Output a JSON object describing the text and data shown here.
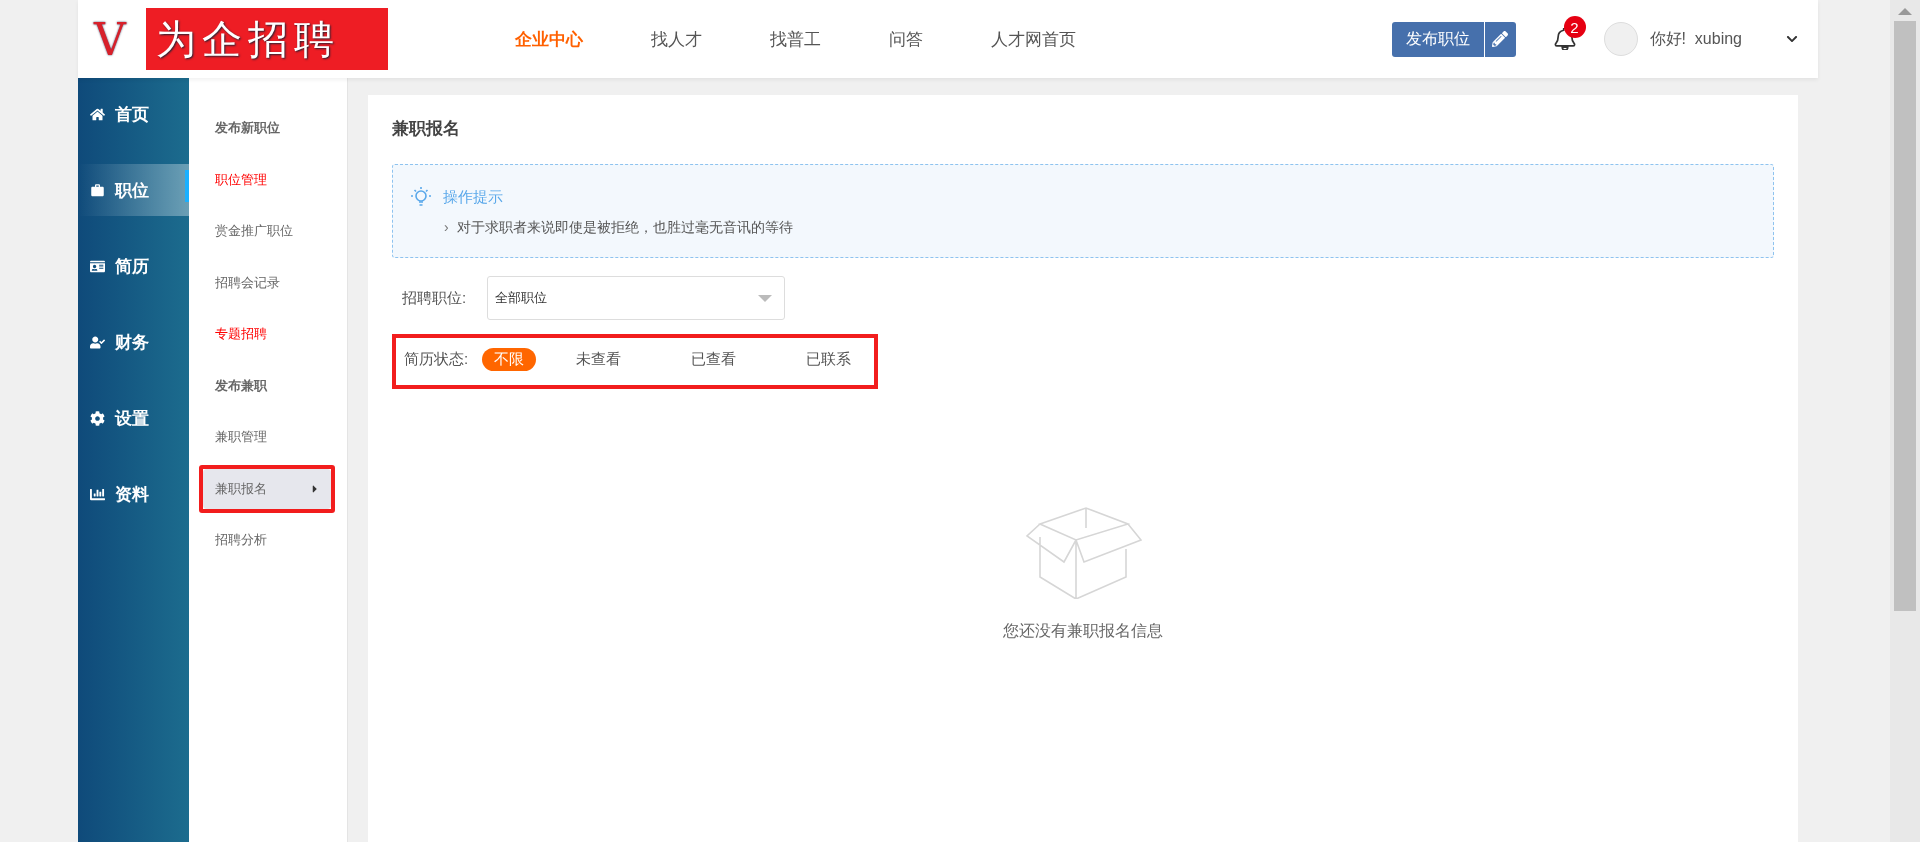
{
  "header": {
    "logo_letter": "V",
    "logo_text": "为企招聘",
    "nav": [
      {
        "label": "企业中心",
        "selected": true
      },
      {
        "label": "找人才",
        "selected": false
      },
      {
        "label": "找普工",
        "selected": false
      },
      {
        "label": "问答",
        "selected": false
      },
      {
        "label": "人才网首页",
        "selected": false
      }
    ],
    "publish_button": "发布职位",
    "notifications": "2",
    "greeting": "你好!  xubing"
  },
  "sidebar": {
    "items": [
      {
        "label": "首页",
        "selected": false
      },
      {
        "label": "职位",
        "selected": true
      },
      {
        "label": "简历",
        "selected": false
      },
      {
        "label": "财务",
        "selected": false
      },
      {
        "label": "设置",
        "selected": false
      },
      {
        "label": "资料",
        "selected": false
      }
    ]
  },
  "submenu": {
    "items": [
      {
        "label": "发布新职位",
        "kind": "bold",
        "selected": false,
        "highlighted": false
      },
      {
        "label": "职位管理",
        "kind": "red",
        "selected": false,
        "highlighted": false
      },
      {
        "label": "赏金推广职位",
        "kind": "plain",
        "selected": false,
        "highlighted": false
      },
      {
        "label": "招聘会记录",
        "kind": "plain",
        "selected": false,
        "highlighted": false
      },
      {
        "label": "专题招聘",
        "kind": "red",
        "selected": false,
        "highlighted": false
      },
      {
        "label": "发布兼职",
        "kind": "bold",
        "selected": false,
        "highlighted": false
      },
      {
        "label": "兼职管理",
        "kind": "plain",
        "selected": false,
        "highlighted": false
      },
      {
        "label": "兼职报名",
        "kind": "plain",
        "selected": true,
        "highlighted": true
      },
      {
        "label": "招聘分析",
        "kind": "plain",
        "selected": false,
        "highlighted": false
      }
    ]
  },
  "content": {
    "title": "兼职报名",
    "tip": {
      "title": "操作提示",
      "bullet": "›",
      "text": "对于求职者来说即使是被拒绝，也胜过毫无音讯的等待"
    },
    "position_filter": {
      "label": "招聘职位:",
      "value": "全部职位"
    },
    "status_filter": {
      "label": "简历状态:",
      "highlighted": true,
      "options": [
        {
          "label": "不限",
          "selected": true
        },
        {
          "label": "未查看",
          "selected": false
        },
        {
          "label": "已查看",
          "selected": false
        },
        {
          "label": "已联系",
          "selected": false
        }
      ]
    },
    "empty_message": "您还没有兼职报名信息"
  }
}
